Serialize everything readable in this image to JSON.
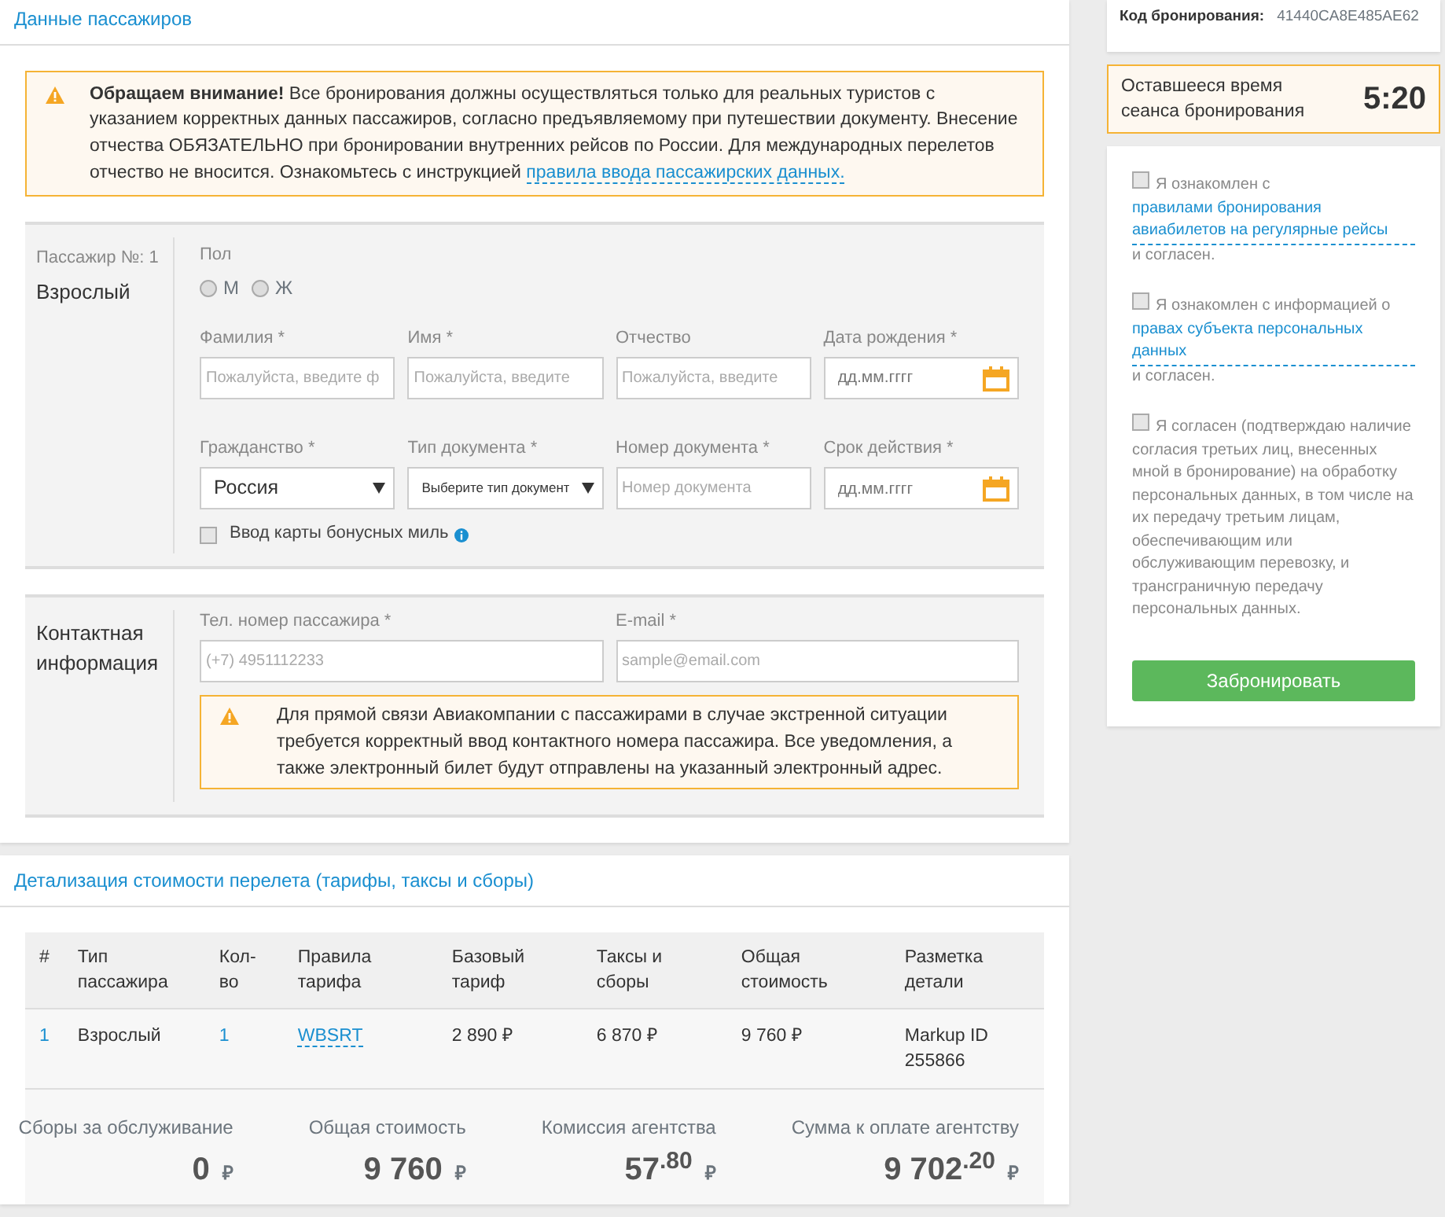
{
  "passengers_section": {
    "title": "Данные пассажиров",
    "notice": {
      "text": "**Обращаем внимание!** Все бронирования должны осуществляться только для реальных туристов с указанием корректных данных пассажиров, согласно предъявляемому при путешествии документу. Внесение отчества ОБЯЗАТЕЛЬНО при бронировании внутренних рейсов по России. Для международных перелетов отчество не вносится. Ознакомьтесь с инструкцией",
      "link": "правила ввода пассажирских данных."
    },
    "passenger": {
      "number_label": "Пассажир №: 1",
      "type": "Взрослый",
      "gender_label": "Пол",
      "gender_options": [
        {
          "label": "М",
          "selected": false
        },
        {
          "label": "Ж",
          "selected": false
        }
      ],
      "fields": [
        {
          "kind": "text",
          "label": "Фамилия *",
          "placeholder": "Пожалуйста, введите ф"
        },
        {
          "kind": "text",
          "label": "Имя *",
          "placeholder": "Пожалуйста, введите"
        },
        {
          "kind": "text",
          "label": "Отчество",
          "placeholder": "Пожалуйста, введите"
        },
        {
          "kind": "date",
          "label": "Дата рождения *",
          "placeholder": "дд.мм.гггг"
        },
        {
          "kind": "select",
          "label": "Гражданство *",
          "value": "Россия"
        },
        {
          "kind": "select",
          "label": "Тип документа *",
          "value": "Выберите тип документ"
        },
        {
          "kind": "text",
          "label": "Номер документа *",
          "placeholder": "Номер документа"
        },
        {
          "kind": "date",
          "label": "Срок действия *",
          "placeholder": "дд.мм.гггг"
        }
      ],
      "bonus_card": {
        "label": "Ввод карты бонусных миль",
        "checked": false
      }
    },
    "contact": {
      "title": "Контактная информация",
      "fields": [
        {
          "label": "Тел. номер пассажира *",
          "placeholder": "(+7) 4951112233"
        },
        {
          "label": "E-mail *",
          "placeholder": "sample@email.com"
        }
      ],
      "notice": "Для прямой связи Авиакомпании с пассажирами в случае экстренной ситуации требуется корректный ввод контактного номера пассажира. Все уведомления, а также электронный билет будут отправлены на указанный электронный адрес."
    }
  },
  "cost_section": {
    "title": "Детализация стоимости перелета (тарифы, таксы и сборы)",
    "table": {
      "columns": [
        "#",
        "Тип пассажира",
        "Кол-во",
        "Правила тарифа",
        "Базовый тариф",
        "Таксы и сборы",
        "Общая стоимость",
        "Разметка детали"
      ],
      "rows": [
        [
          "1",
          "Взрослый",
          "1",
          "WBSRT",
          "2 890 ₽",
          "6 870 ₽",
          "9 760 ₽",
          "Markup ID 255866"
        ]
      ]
    },
    "totals": [
      {
        "label": "Сборы за обслуживание",
        "value": "0",
        "currency": "₽"
      },
      {
        "label": "Общая стоимость",
        "value": "9 760",
        "currency": "₽"
      },
      {
        "label": "Комиссия агентства",
        "value": "57$^{.80}$",
        "currency": "₽"
      },
      {
        "label": "Сумма к оплате агентству",
        "value": "9 702$^{.20}$",
        "currency": "₽"
      }
    ]
  },
  "sidebar": {
    "booking_code": {
      "label": "Код бронирования:",
      "value": "41440CA8E485AE62"
    },
    "timer": {
      "label": "Оставшееся время сеанса бронирования",
      "value": "5:20"
    },
    "agreements": [
      {
        "checked": false,
        "text_before": "Я ознакомлен с",
        "link": "правилами бронирования авиабилетов на регулярные рейсы",
        "text_after": "и согласен."
      },
      {
        "checked": false,
        "text_before": "Я ознакомлен с информацией о",
        "link": "правах субъекта персональных данных",
        "text_after": "и согласен."
      },
      {
        "checked": false,
        "text_before": "Я согласен (подтверждаю наличие согласия третьих лиц, внесенных мной в бронирование) на обработку персональных данных, в том числе на их передачу третьим лицам, обеспечивающим или обслуживающим перевозку, и трансграничную передачу персональных данных."
      }
    ],
    "submit": "Забронировать"
  }
}
